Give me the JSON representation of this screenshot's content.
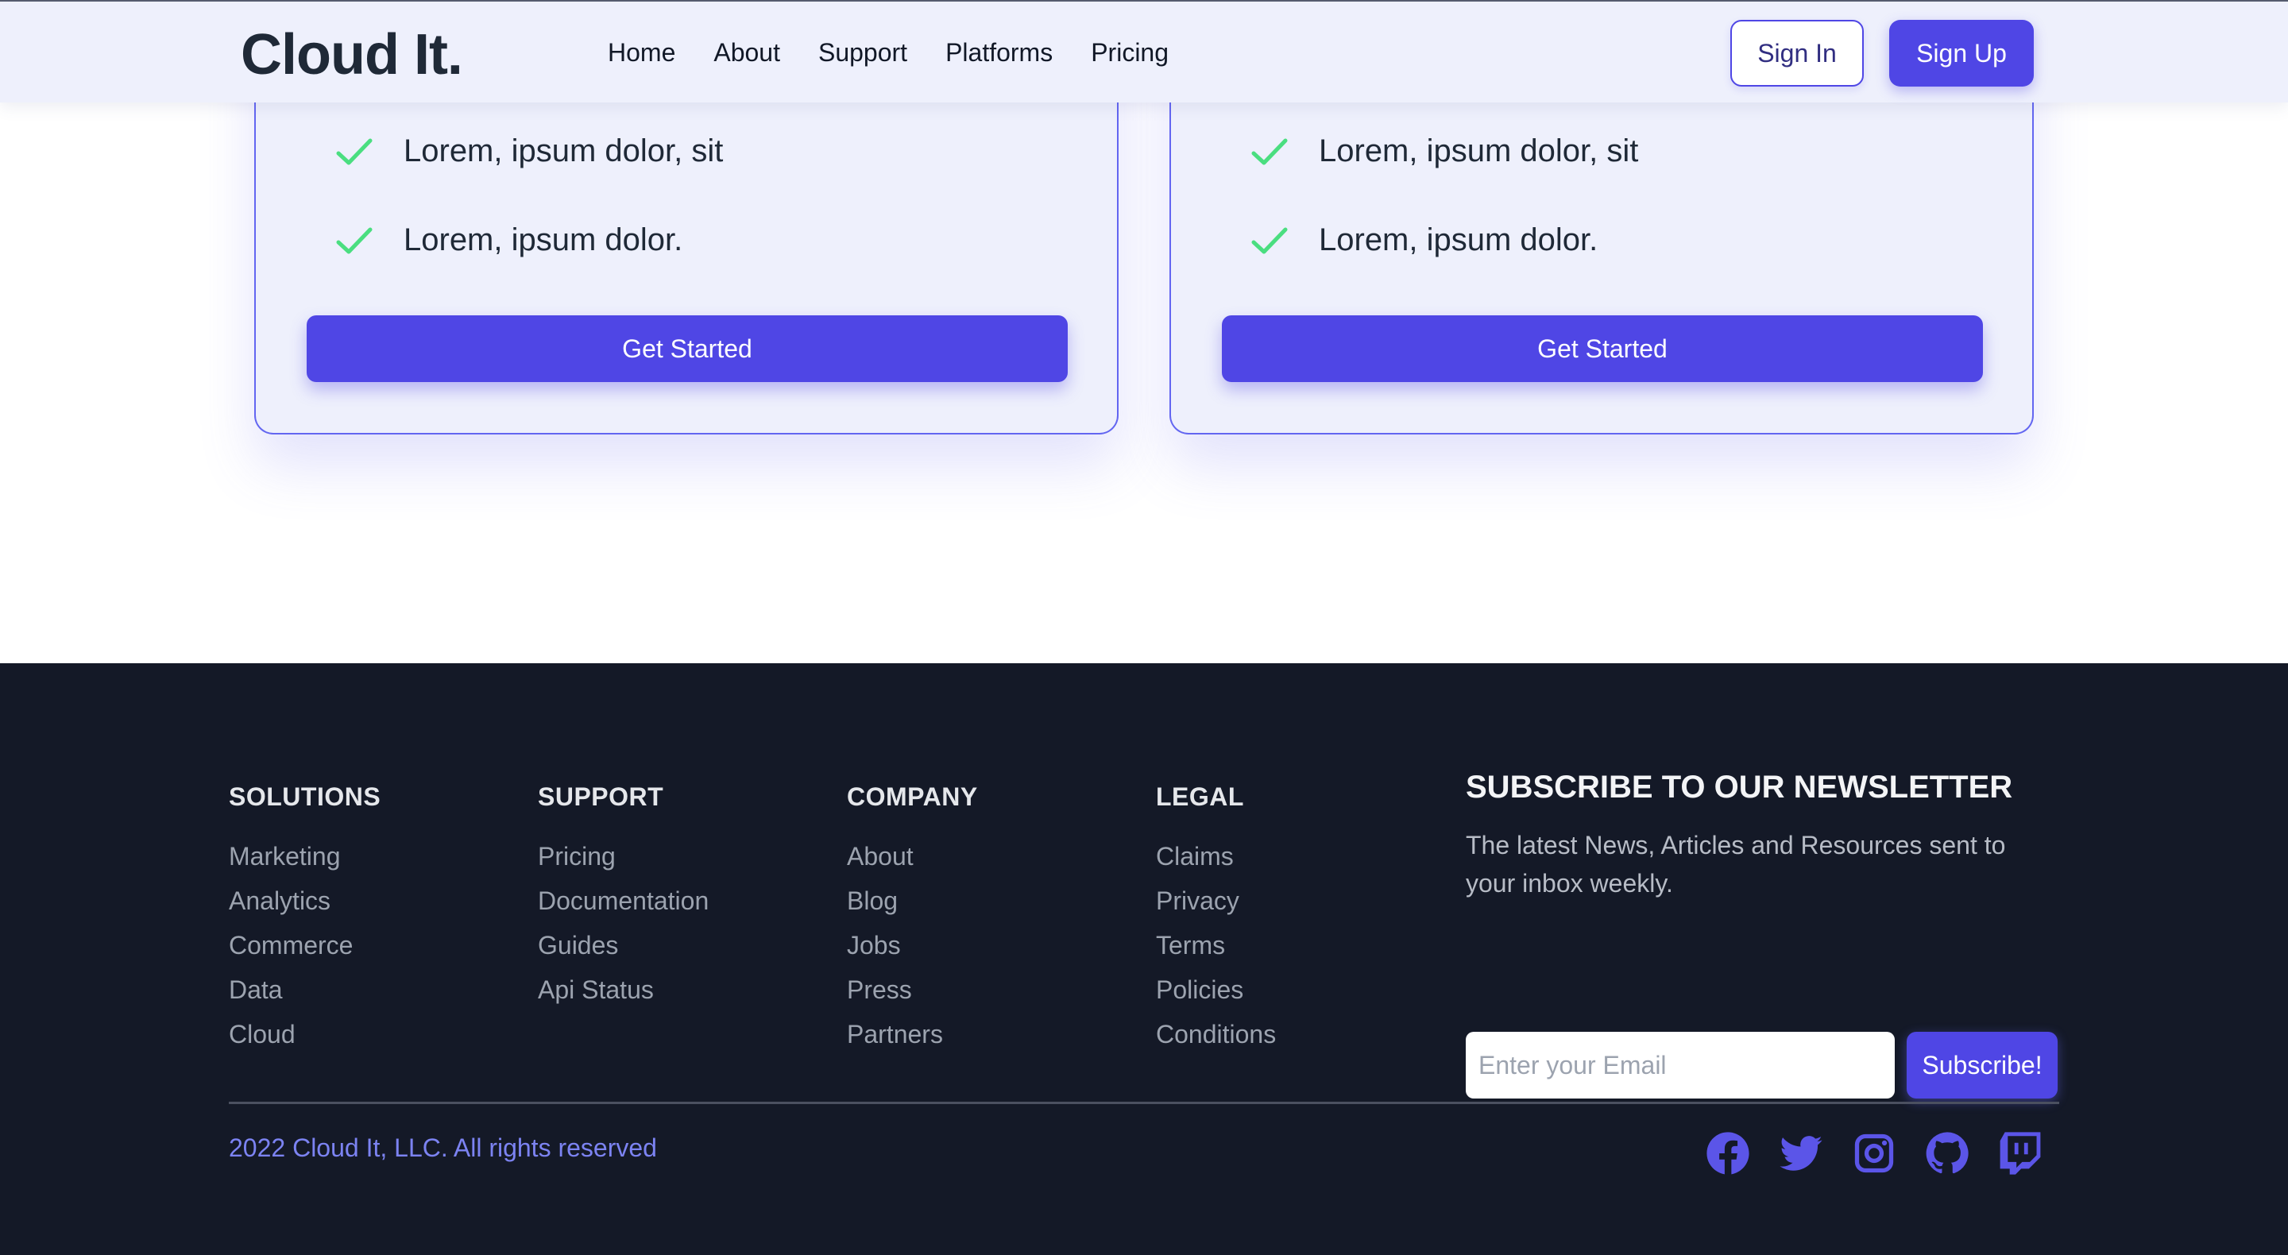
{
  "navbar": {
    "logo": "Cloud It.",
    "links": [
      "Home",
      "About",
      "Support",
      "Platforms",
      "Pricing"
    ],
    "sign_in": "Sign In",
    "sign_up": "Sign Up"
  },
  "cards": [
    {
      "features": [
        "Lorem, ipsum dolor, sit",
        "Lorem, ipsum dolor."
      ],
      "cta": "Get Started"
    },
    {
      "features": [
        "Lorem, ipsum dolor, sit",
        "Lorem, ipsum dolor."
      ],
      "cta": "Get Started"
    }
  ],
  "footer": {
    "columns": [
      {
        "title": "SOLUTIONS",
        "links": [
          "Marketing",
          "Analytics",
          "Commerce",
          "Data",
          "Cloud"
        ]
      },
      {
        "title": "SUPPORT",
        "links": [
          "Pricing",
          "Documentation",
          "Guides",
          "Api Status"
        ]
      },
      {
        "title": "COMPANY",
        "links": [
          "About",
          "Blog",
          "Jobs",
          "Press",
          "Partners"
        ]
      },
      {
        "title": "LEGAL",
        "links": [
          "Claims",
          "Privacy",
          "Terms",
          "Policies",
          "Conditions"
        ]
      }
    ],
    "newsletter": {
      "title": "SUBSCRIBE TO OUR NEWSLETTER",
      "text": "The latest News, Articles and Resources sent to your inbox weekly.",
      "email_placeholder": "Enter your Email",
      "button": "Subscribe!"
    },
    "copyright": "2022 Cloud It, LLC. All rights reserved",
    "socials": [
      "facebook-icon",
      "twitter-icon",
      "instagram-icon",
      "github-icon",
      "twitch-icon"
    ]
  },
  "colors": {
    "accent": "#4f46e5",
    "nav_bg": "#eef0fc",
    "footer_bg": "#141927",
    "check": "#4ade80"
  }
}
